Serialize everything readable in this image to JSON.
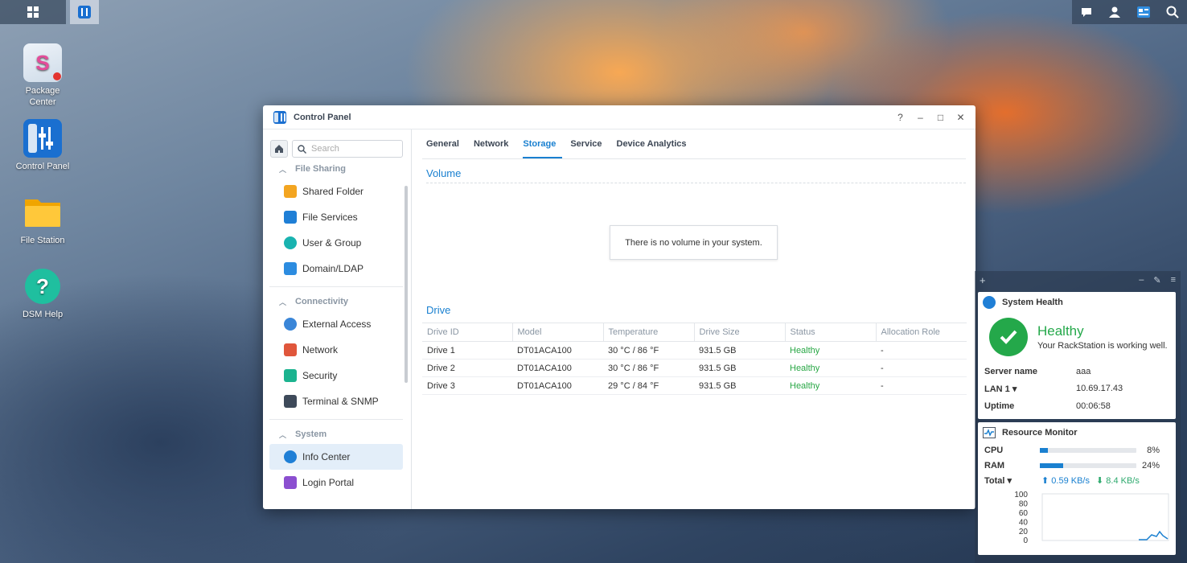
{
  "taskbar": {
    "apps_icon": "grid-icon",
    "right_icons": [
      "chat-icon",
      "user-icon",
      "widgets-icon",
      "search-icon"
    ]
  },
  "desktop": {
    "icons": [
      {
        "label": "Package\nCenter",
        "line1": "Package",
        "line2": "Center"
      },
      {
        "label": "Control Panel"
      },
      {
        "label": "File Station"
      },
      {
        "label": "DSM Help"
      }
    ]
  },
  "window": {
    "title": "Control Panel",
    "controls": {
      "help": "?",
      "minimize": "–",
      "maximize": "□",
      "close": "✕"
    },
    "search_placeholder": "Search",
    "sidebar": {
      "sections": [
        {
          "label": "File Sharing",
          "items": [
            "Shared Folder",
            "File Services",
            "User & Group",
            "Domain/LDAP"
          ]
        },
        {
          "label": "Connectivity",
          "items": [
            "External Access",
            "Network",
            "Security",
            "Terminal & SNMP"
          ]
        },
        {
          "label": "System",
          "items": [
            "Info Center",
            "Login Portal"
          ]
        }
      ],
      "active_item": "Info Center"
    },
    "tabs": [
      "General",
      "Network",
      "Storage",
      "Service",
      "Device Analytics"
    ],
    "active_tab": "Storage",
    "volume": {
      "title": "Volume",
      "empty_message": "There is no volume in your system."
    },
    "drive": {
      "title": "Drive",
      "columns": [
        "Drive ID",
        "Model",
        "Temperature",
        "Drive Size",
        "Status",
        "Allocation Role"
      ],
      "rows": [
        [
          "Drive 1",
          "DT01ACA100",
          "30 °C / 86 °F",
          "931.5 GB",
          "Healthy",
          "-"
        ],
        [
          "Drive 2",
          "DT01ACA100",
          "30 °C / 86 °F",
          "931.5 GB",
          "Healthy",
          "-"
        ],
        [
          "Drive 3",
          "DT01ACA100",
          "29 °C / 84 °F",
          "931.5 GB",
          "Healthy",
          "-"
        ]
      ]
    }
  },
  "widgets": {
    "add": "+",
    "system_health": {
      "title": "System Health",
      "status": "Healthy",
      "subtitle": "Your RackStation is working well.",
      "server_name_label": "Server name",
      "server_name": "aaa",
      "lan_label": "LAN 1 ▾",
      "lan_ip": "10.69.17.43",
      "uptime_label": "Uptime",
      "uptime": "00:06:58"
    },
    "resource_monitor": {
      "title": "Resource Monitor",
      "cpu_label": "CPU",
      "cpu_pct": "8%",
      "cpu_value": 8,
      "ram_label": "RAM",
      "ram_pct": "24%",
      "ram_value": 24,
      "total_label": "Total ▾",
      "upload": "0.59 KB/s",
      "download": "8.4 KB/s",
      "chart_ticks": [
        "100",
        "80",
        "60",
        "40",
        "20",
        "0"
      ],
      "colors": {
        "accent": "#1a80d0",
        "download": "#2eaa6e"
      }
    }
  }
}
